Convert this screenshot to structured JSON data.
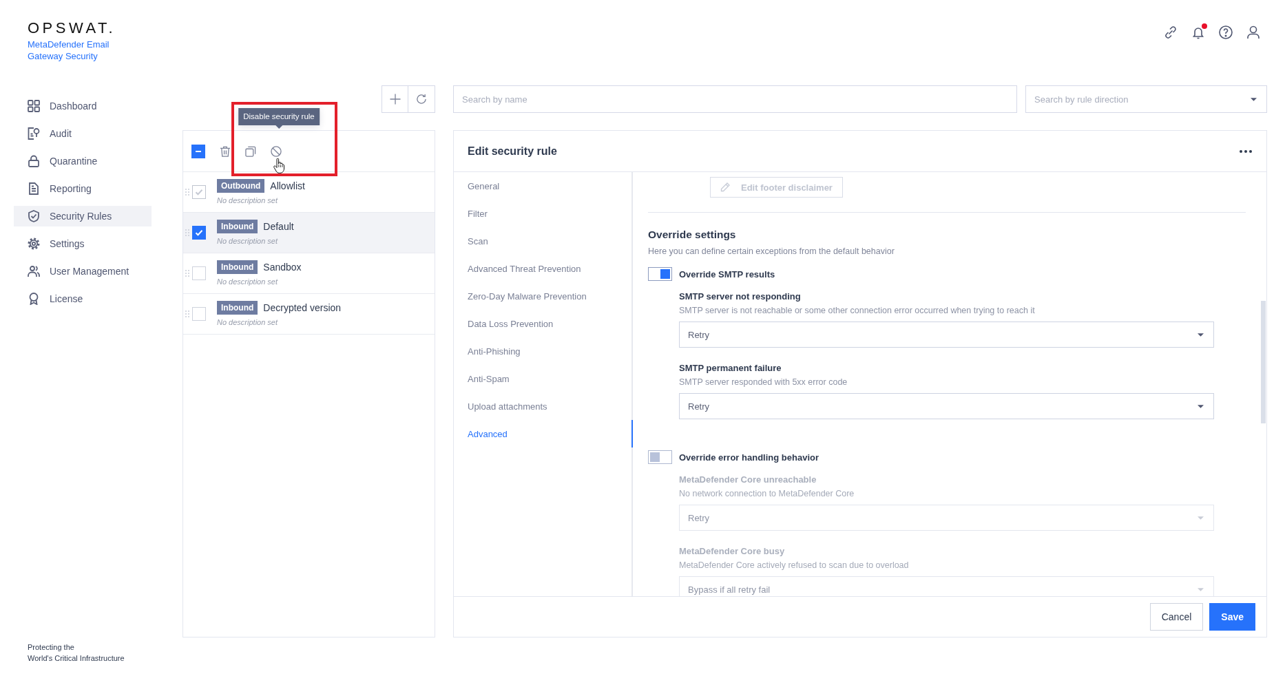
{
  "app": {
    "logo": "OPSWAT.",
    "product_lines": [
      "MetaDefender Email",
      "Gateway Security"
    ]
  },
  "sidebar": {
    "items": [
      {
        "label": "Dashboard",
        "selected": false
      },
      {
        "label": "Audit",
        "selected": false
      },
      {
        "label": "Quarantine",
        "selected": false
      },
      {
        "label": "Reporting",
        "selected": false
      },
      {
        "label": "Security Rules",
        "selected": true
      },
      {
        "label": "Settings",
        "selected": false
      },
      {
        "label": "User Management",
        "selected": false
      },
      {
        "label": "License",
        "selected": false
      }
    ],
    "tagline_lines": [
      "Protecting the",
      "World's Critical Infrastructure"
    ]
  },
  "header": {
    "notifications_unread": true
  },
  "search": {
    "name_placeholder": "Search by name",
    "direction_placeholder": "Search by rule direction"
  },
  "rules_panel": {
    "select_all": {
      "indeterminate": true
    },
    "tooltip": "Disable security rule",
    "rules": [
      {
        "direction": "Outbound",
        "name": "Allowlist",
        "description": "No description set",
        "checked": true,
        "disabled": true,
        "selected": false
      },
      {
        "direction": "Inbound",
        "name": "Default",
        "description": "No description set",
        "checked": true,
        "disabled": false,
        "selected": true
      },
      {
        "direction": "Inbound",
        "name": "Sandbox",
        "description": "No description set",
        "checked": false,
        "disabled": false,
        "selected": false
      },
      {
        "direction": "Inbound",
        "name": "Decrypted version",
        "description": "No description set",
        "checked": false,
        "disabled": false,
        "selected": false
      }
    ]
  },
  "editor": {
    "title": "Edit security rule",
    "nav": [
      {
        "label": "General",
        "selected": false
      },
      {
        "label": "Filter",
        "selected": false
      },
      {
        "label": "Scan",
        "selected": false
      },
      {
        "label": "Advanced Threat Prevention",
        "selected": false
      },
      {
        "label": "Zero-Day Malware Prevention",
        "selected": false
      },
      {
        "label": "Data Loss Prevention",
        "selected": false
      },
      {
        "label": "Anti-Phishing",
        "selected": false
      },
      {
        "label": "Anti-Spam",
        "selected": false
      },
      {
        "label": "Upload attachments",
        "selected": false
      },
      {
        "label": "Advanced",
        "selected": true
      }
    ],
    "disclaimer_button": {
      "label": "Edit footer disclaimer",
      "disabled": true
    },
    "override": {
      "title": "Override settings",
      "description": "Here you can define certain exceptions from the default behavior"
    },
    "groups": [
      {
        "label": "Override SMTP results",
        "on": true,
        "fields": [
          {
            "label": "SMTP server not responding",
            "description": "SMTP server is not reachable or some other connection error occurred when trying to reach it",
            "value": "Retry"
          },
          {
            "label": "SMTP permanent failure",
            "description": "SMTP server responded with 5xx error code",
            "value": "Retry"
          }
        ]
      },
      {
        "label": "Override error handling behavior",
        "on": false,
        "fields": [
          {
            "label": "MetaDefender Core unreachable",
            "description": "No network connection to MetaDefender Core",
            "value": "Retry"
          },
          {
            "label": "MetaDefender Core busy",
            "description": "MetaDefender Core actively refused to scan due to overload",
            "value": "Bypass if all retry fail"
          }
        ]
      }
    ],
    "buttons": [
      {
        "label": "Cancel",
        "kind": "secondary"
      },
      {
        "label": "Save",
        "kind": "primary"
      }
    ]
  }
}
